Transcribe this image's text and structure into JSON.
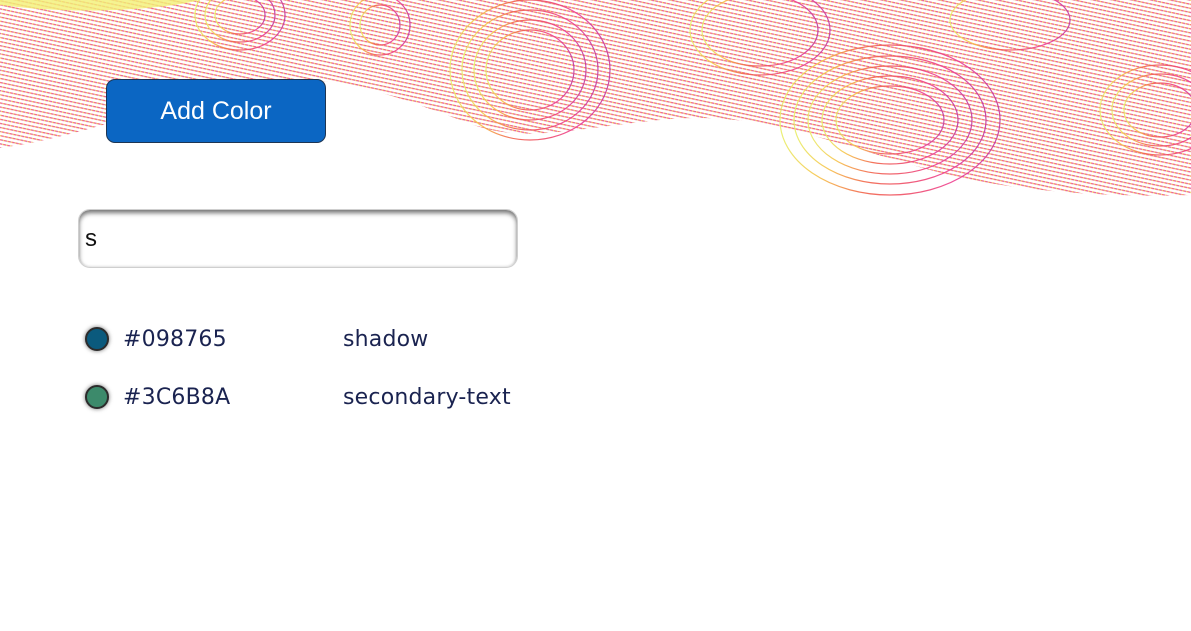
{
  "toolbar": {
    "add_color_label": "Add Color"
  },
  "search": {
    "value": "s",
    "placeholder": ""
  },
  "colors": [
    {
      "hex": "#098765",
      "name": "shadow",
      "swatch": "#0b5a7d"
    },
    {
      "hex": "#3C6B8A",
      "name": "secondary-text",
      "swatch": "#3c8a6b"
    }
  ],
  "theme": {
    "button_color": "#0b66c3",
    "text_color": "#1a2350"
  }
}
